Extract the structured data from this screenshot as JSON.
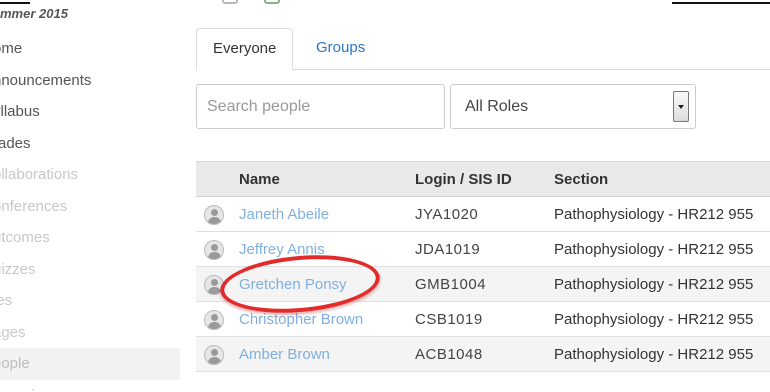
{
  "sidebar": {
    "term": "mmer 2015",
    "items": [
      {
        "label": "ome",
        "state": "on"
      },
      {
        "label": "nnouncements",
        "state": "on"
      },
      {
        "label": "yllabus",
        "state": "on"
      },
      {
        "label": "rades",
        "state": "on"
      },
      {
        "label": "ollaborations",
        "state": "off"
      },
      {
        "label": "onferences",
        "state": "off"
      },
      {
        "label": "utcomes",
        "state": "off"
      },
      {
        "label": "uizzes",
        "state": "off"
      },
      {
        "label": "les",
        "state": "off"
      },
      {
        "label": "ages",
        "state": "off"
      },
      {
        "label": "eople",
        "state": "active"
      },
      {
        "label": "scussions",
        "state": "off"
      }
    ]
  },
  "tabs": {
    "everyone": "Everyone",
    "groups": "Groups"
  },
  "filters": {
    "search_placeholder": "Search people",
    "roles_value": "All Roles"
  },
  "table": {
    "headers": {
      "name": "Name",
      "login": "Login / SIS ID",
      "section": "Section"
    },
    "rows": [
      {
        "name": "Janeth Abeile",
        "login": "JYA1020",
        "section": "Pathophysiology - HR212 955"
      },
      {
        "name": "Jeffrey Annis",
        "login": "JDA1019",
        "section": "Pathophysiology - HR212 955"
      },
      {
        "name": "Gretchen Ponsy",
        "login": "GMB1004",
        "section": "Pathophysiology - HR212 955"
      },
      {
        "name": "Christopher Brown",
        "login": "CSB1019",
        "section": "Pathophysiology - HR212 955"
      },
      {
        "name": "Amber Brown",
        "login": "ACB1048",
        "section": "Pathophysiology - HR212 955"
      }
    ]
  },
  "colors": {
    "link": "#2a76c6",
    "annotation_circle": "#e22b2b"
  }
}
